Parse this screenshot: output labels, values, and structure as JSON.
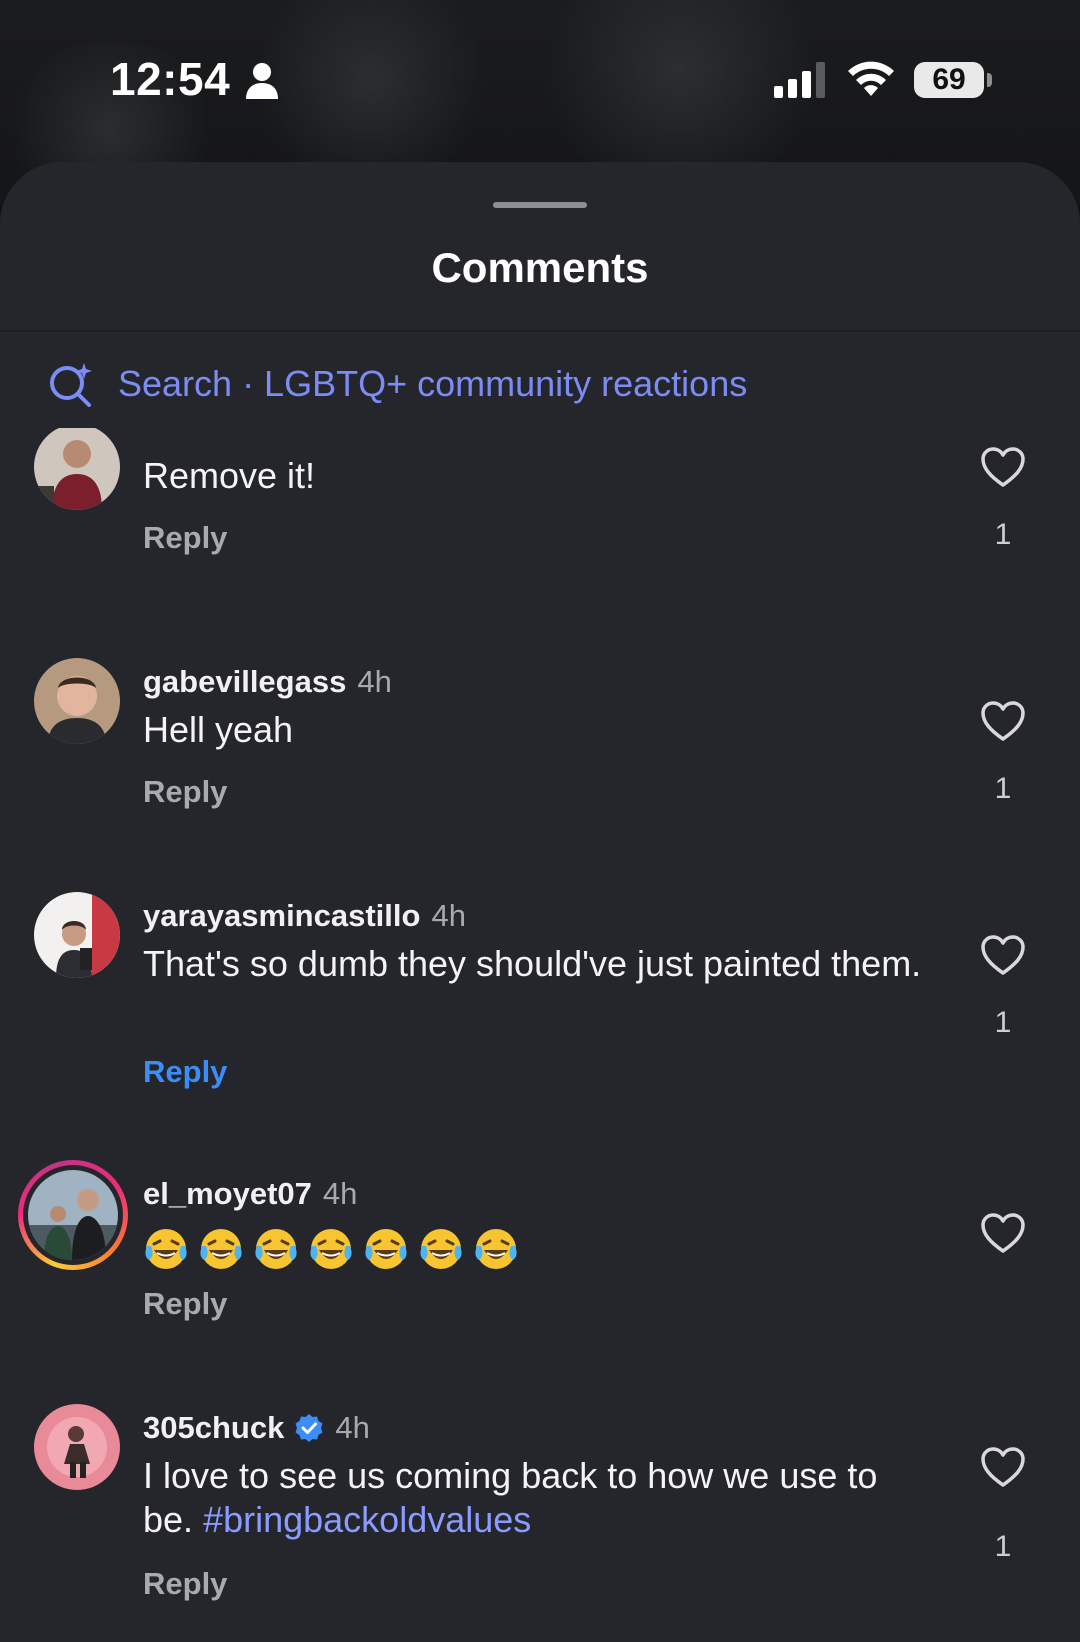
{
  "status_bar": {
    "time": "12:54",
    "battery": "69"
  },
  "sheet": {
    "title": "Comments",
    "search": {
      "label": "Search · LGBTQ+ community reactions"
    }
  },
  "comments": [
    {
      "username": "",
      "time": "",
      "text": "Remove it!",
      "reply": "Reply",
      "likes": "1"
    },
    {
      "username": "gabevillegass",
      "time": "4h",
      "text": "Hell yeah",
      "reply": "Reply",
      "likes": "1"
    },
    {
      "username": "yarayasmincastillo",
      "time": "4h",
      "text": "That's so dumb they should've just painted them.",
      "reply": "Reply",
      "likes": "1"
    },
    {
      "username": "el_moyet07",
      "time": "4h",
      "emoji": [
        "😂",
        "😂",
        "😂",
        "😂",
        "😂",
        "😂",
        "😂"
      ],
      "reply": "Reply"
    },
    {
      "username": "305chuck",
      "time": "4h",
      "text": "I love to see us coming back to how we use to be.",
      "hashtag": "#bringbackoldvalues",
      "reply": "Reply",
      "likes": "1"
    }
  ],
  "colors": {
    "sheet_bg": "#25262b",
    "accent_search": "#7c8cf5",
    "reply_active": "#3d8df6",
    "hashtag": "#8a9cff",
    "verified": "#3d8df6"
  },
  "icons": [
    "person-icon",
    "signal-icon",
    "wifi-icon",
    "search-sparkle-icon",
    "heart-icon",
    "verified-badge-icon",
    "laughing-tears-emoji"
  ]
}
